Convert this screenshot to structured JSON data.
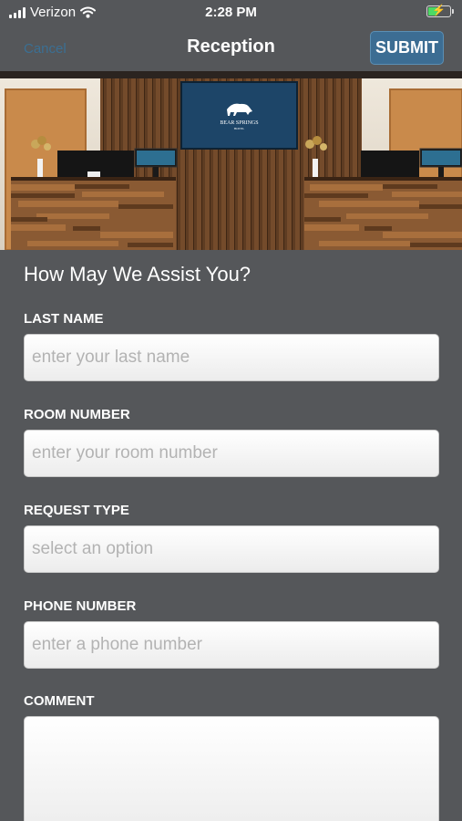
{
  "status_bar": {
    "carrier": "Verizon",
    "time": "2:28 PM",
    "battery_level": 0.4
  },
  "nav": {
    "cancel_label": "Cancel",
    "title": "Reception",
    "submit_label": "SUBMIT"
  },
  "hero": {
    "sign_text_main": "BEAR SPRINGS",
    "sign_text_sub": "HOTEL"
  },
  "form": {
    "heading": "How May We Assist You?",
    "last_name": {
      "label": "LAST NAME",
      "placeholder": "enter your last name"
    },
    "room_number": {
      "label": "ROOM NUMBER",
      "placeholder": "enter your room number"
    },
    "request_type": {
      "label": "REQUEST TYPE",
      "placeholder": "select an option"
    },
    "phone_number": {
      "label": "PHONE NUMBER",
      "placeholder": "enter a phone number"
    },
    "comment": {
      "label": "COMMENT",
      "placeholder": ""
    }
  },
  "colors": {
    "background": "#55575a",
    "accent": "#3c6d93",
    "cancel_text": "#3b6f93"
  }
}
